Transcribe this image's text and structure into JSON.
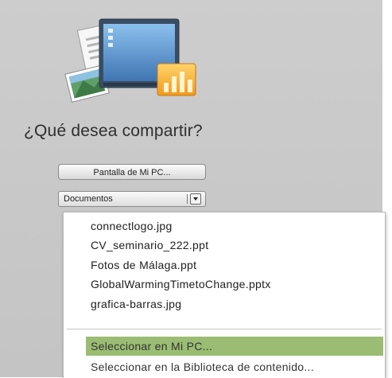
{
  "heading": "¿Qué desea compartir?",
  "screen_button_label": "Pantalla de Mi PC...",
  "source_select": {
    "selected": "Documentos"
  },
  "dropdown": {
    "files": [
      "connectlogo.jpg",
      "CV_seminario_222.ppt",
      "Fotos de Málaga.ppt",
      "GlobalWarmingTimetoChange.pptx",
      "grafica-barras.jpg"
    ],
    "actions": [
      "Seleccionar en Mi PC...",
      "Seleccionar en la Biblioteca de contenido..."
    ],
    "highlight_color": "#9abd73"
  },
  "icons": [
    "share-documents-illustration-icon",
    "chevron-down-icon"
  ]
}
